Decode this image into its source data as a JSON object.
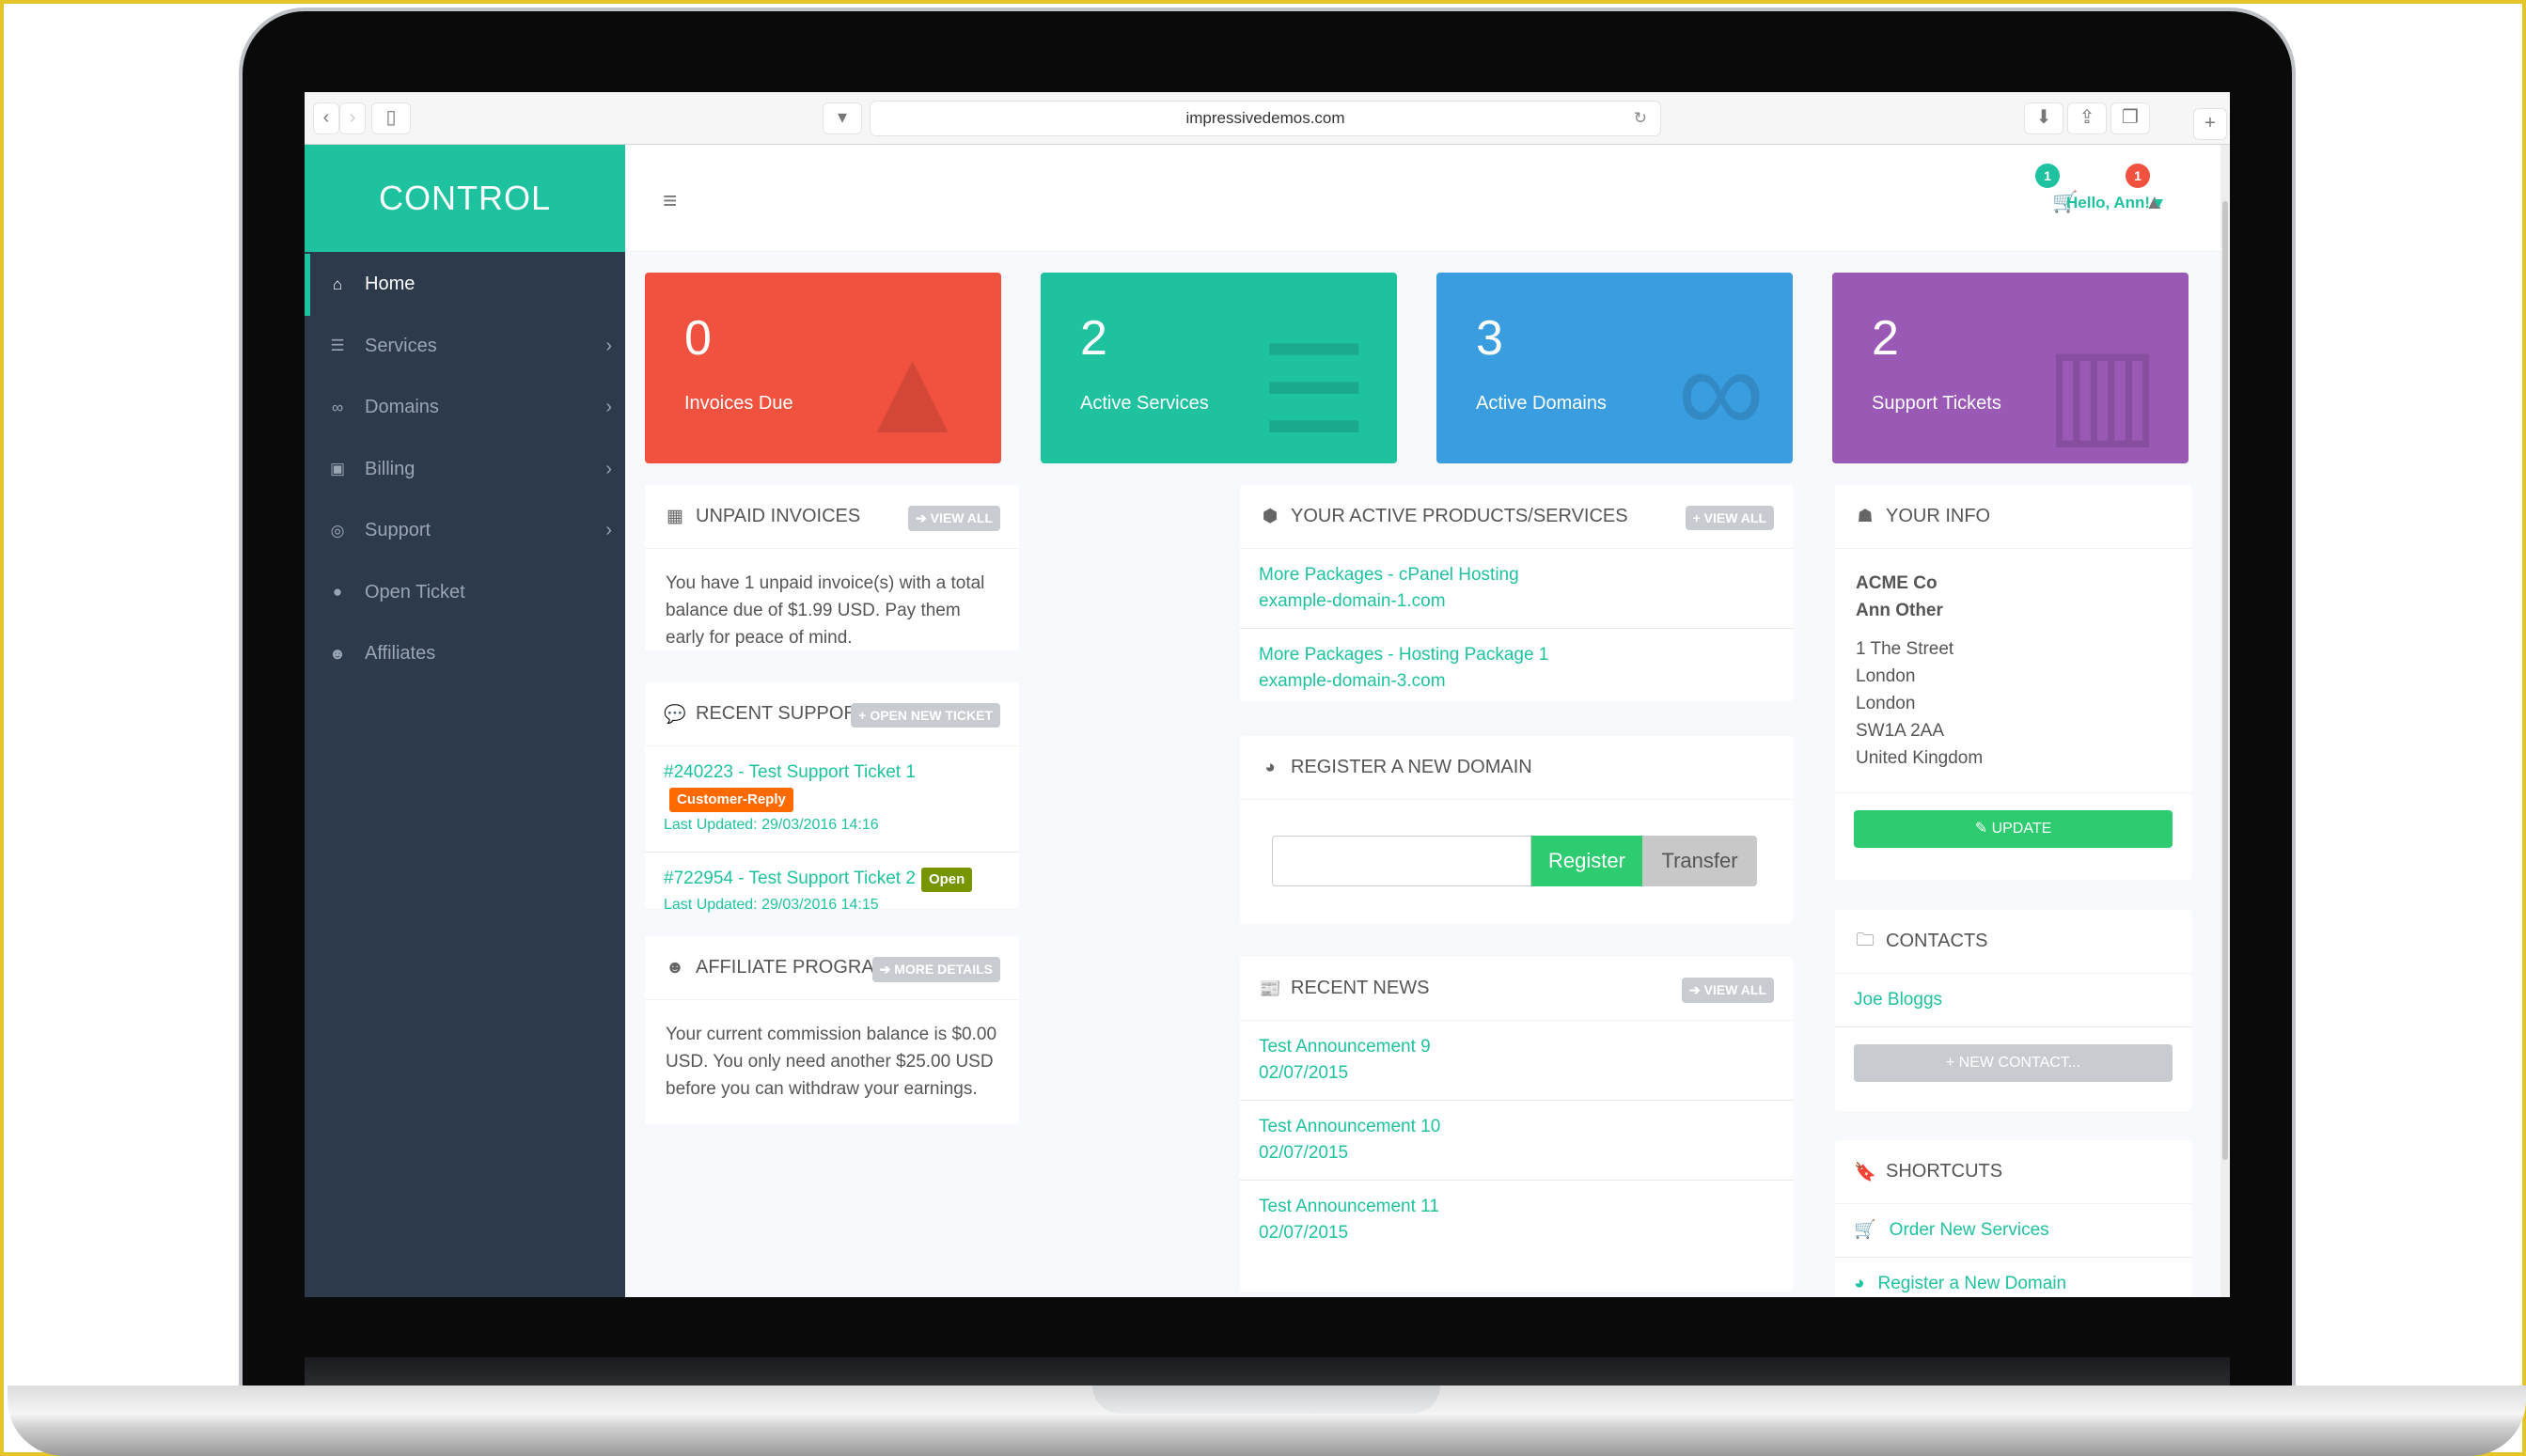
{
  "browser": {
    "url": "impressivedemos.com",
    "back_icon": "‹",
    "forward_icon": "›"
  },
  "brand": {
    "name": "CONTROL"
  },
  "sidebar": {
    "items": [
      {
        "label": "Home",
        "icon": "home-icon",
        "glyph": "⌂",
        "active": true,
        "has_submenu": false
      },
      {
        "label": "Services",
        "icon": "server-icon",
        "glyph": "☰",
        "has_submenu": true
      },
      {
        "label": "Domains",
        "icon": "link-icon",
        "glyph": "∞",
        "has_submenu": true
      },
      {
        "label": "Billing",
        "icon": "money-icon",
        "glyph": "▣",
        "has_submenu": true
      },
      {
        "label": "Support",
        "icon": "lifebuoy-icon",
        "glyph": "◎",
        "has_submenu": true
      },
      {
        "label": "Open Ticket",
        "icon": "comment-icon",
        "glyph": "●",
        "has_submenu": false
      },
      {
        "label": "Affiliates",
        "icon": "users-icon",
        "glyph": "☻",
        "has_submenu": false
      }
    ],
    "chevron": "›"
  },
  "topbar": {
    "cart_count": "1",
    "alerts_count": "1",
    "greeting": "Hello, Ann!",
    "caret": "▾"
  },
  "stats": [
    {
      "value": "0",
      "label": "Invoices Due",
      "color": "#f0523f",
      "icon": "warning-icon",
      "glyph": "▲"
    },
    {
      "value": "2",
      "label": "Active Services",
      "color": "#1fc29f",
      "icon": "server-icon",
      "glyph": "☰"
    },
    {
      "value": "3",
      "label": "Active Domains",
      "color": "#3a9de0",
      "icon": "link-icon",
      "glyph": "∞"
    },
    {
      "value": "2",
      "label": "Support Tickets",
      "color": "#9b59b6",
      "icon": "inbox-icon",
      "glyph": "▥"
    }
  ],
  "unpaid_invoices": {
    "title": "UNPAID INVOICES",
    "button": "➔ VIEW ALL",
    "text": "You have 1 unpaid invoice(s) with a total balance due of $1.99 USD. Pay them early for peace of mind."
  },
  "support_tickets": {
    "title": "RECENT SUPPORT TICKETS",
    "button": "+ OPEN NEW TICKET",
    "tickets": [
      {
        "title": "#240223 - Test Support Ticket 1",
        "status": "Customer-Reply",
        "status_color": "#ff6a00",
        "updated": "Last Updated: 29/03/2016 14:16"
      },
      {
        "title": "#722954 - Test Support Ticket 2",
        "status": "Open",
        "status_color": "#779500",
        "updated": "Last Updated: 29/03/2016 14:15"
      }
    ]
  },
  "affiliate": {
    "title": "AFFILIATE PROGRAM",
    "button": "➔ MORE DETAILS",
    "text": "Your current commission balance is $0.00 USD. You only need another $25.00 USD before you can withdraw your earnings."
  },
  "products": {
    "title": "YOUR ACTIVE PRODUCTS/SERVICES",
    "button": "+ VIEW ALL",
    "items": [
      {
        "name": "More Packages - cPanel Hosting",
        "domain": "example-domain-1.com"
      },
      {
        "name": "More Packages - Hosting Package 1",
        "domain": "example-domain-3.com"
      }
    ]
  },
  "register_domain": {
    "title": "REGISTER A NEW DOMAIN",
    "input_value": "",
    "register": "Register",
    "transfer": "Transfer"
  },
  "news": {
    "title": "RECENT NEWS",
    "button": "➔ VIEW ALL",
    "items": [
      {
        "title": "Test Announcement 9",
        "date": "02/07/2015"
      },
      {
        "title": "Test Announcement 10",
        "date": "02/07/2015"
      },
      {
        "title": "Test Announcement 11",
        "date": "02/07/2015"
      }
    ]
  },
  "your_info": {
    "title": "YOUR INFO",
    "company": "ACME Co",
    "name": "Ann Other",
    "address": [
      "1 The Street",
      "London",
      "London",
      "SW1A 2AA",
      "United Kingdom"
    ],
    "button": "✎ UPDATE"
  },
  "contacts": {
    "title": "CONTACTS",
    "items": [
      "Joe Bloggs"
    ],
    "button": "+ NEW CONTACT..."
  },
  "shortcuts": {
    "title": "SHORTCUTS",
    "items": [
      {
        "label": "Order New Services",
        "icon": "cart-icon",
        "glyph": "🛒"
      },
      {
        "label": "Register a New Domain",
        "icon": "globe-icon",
        "glyph": "◕"
      }
    ]
  }
}
